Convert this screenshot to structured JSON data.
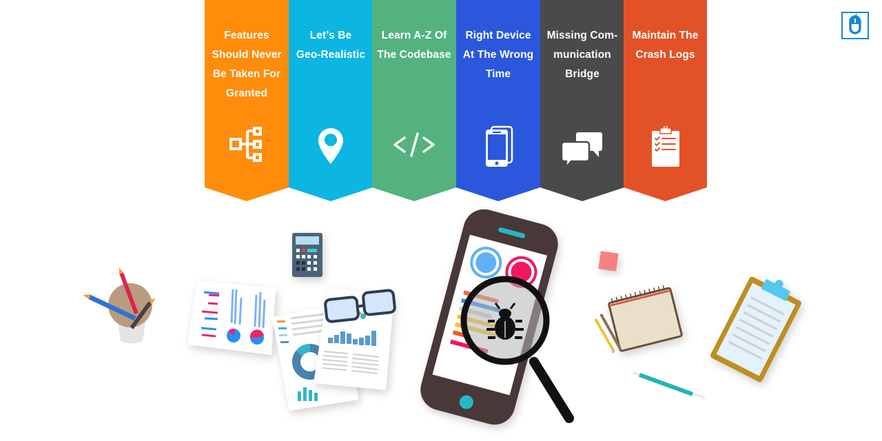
{
  "banners": [
    {
      "title": "Features Should Never Be Taken For Granted",
      "lines": [
        "Features",
        "Should Never",
        "Be Taken For",
        "Granted"
      ],
      "icon": "hierarchy-icon",
      "color": "#FF8C0A"
    },
    {
      "title": "Let’s Be Geo-Realistic",
      "lines": [
        "Let’s Be",
        "Geo-Realistic"
      ],
      "icon": "location-pin-icon",
      "color": "#0DB5E2"
    },
    {
      "title": "Learn A-Z Of The Codebase",
      "lines": [
        "Learn A-Z Of",
        "The Codebase"
      ],
      "icon": "code-icon",
      "color": "#53B27E"
    },
    {
      "title": "Right Device At The Wrong Time",
      "lines": [
        "Right Device",
        "At The Wrong",
        "Time"
      ],
      "icon": "mobile-devices-icon",
      "color": "#2B57DC"
    },
    {
      "title": "Missing Communication Bridge",
      "lines": [
        "Missing Com-",
        "munication",
        "Bridge"
      ],
      "icon": "chat-bubbles-icon",
      "color": "#4A4A4A"
    },
    {
      "title": "Maintain The Crash Logs",
      "lines": [
        "Maintain The",
        "Crash Logs"
      ],
      "icon": "checklist-clipboard-icon",
      "color": "#E35227"
    }
  ],
  "logo": {
    "icon": "mouse-logo-icon",
    "color": "#1A87CF"
  },
  "illustration": {
    "items": [
      "pencil-cup",
      "calculator",
      "report-papers",
      "glasses",
      "smartphone",
      "magnifier-bug",
      "sticky-note",
      "notebook",
      "pencils",
      "clipboard",
      "pen"
    ]
  }
}
